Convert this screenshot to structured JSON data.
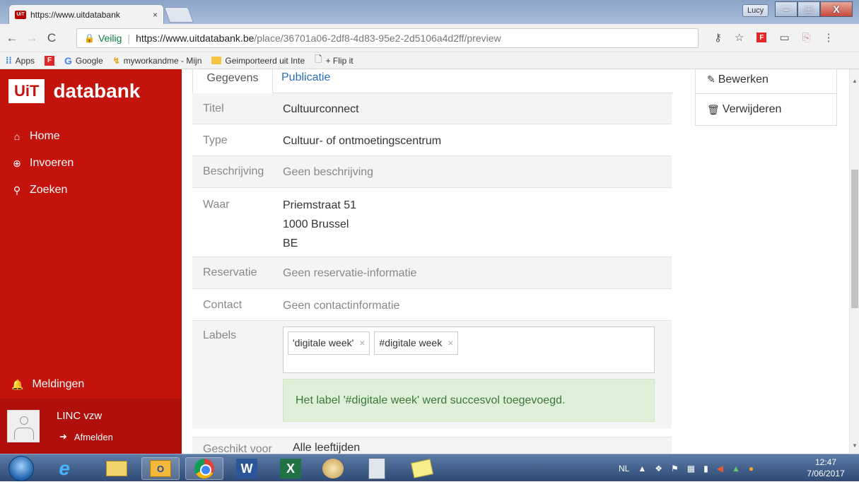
{
  "browser": {
    "tab_title": "https://www.uitdatabank",
    "tab_close": "×",
    "user_badge": "Lucy",
    "window_minimize": "–",
    "window_maximize": "□",
    "window_close": "X",
    "nav_back": "←",
    "nav_forward": "→",
    "nav_reload": "C",
    "secure_label": "Veilig",
    "url_host": "https://www.uitdatabank.be",
    "url_path": "/place/36701a06-2df8-4d83-95e2-2d5106a4d2ff/preview",
    "bookmarks": [
      {
        "label": "Apps",
        "icon": "apps-icon"
      },
      {
        "label": "",
        "icon": "flipboard-icon"
      },
      {
        "label": "Google",
        "icon": "google-icon"
      },
      {
        "label": "myworkandme - Mijn",
        "icon": "myworkandme-icon"
      },
      {
        "label": "Geimporteerd uit Inte",
        "icon": "folder-icon"
      },
      {
        "label": "+ Flip it",
        "icon": "page-icon"
      }
    ]
  },
  "sidebar": {
    "logo_box": "UiT",
    "logo_text": "databank",
    "nav": [
      {
        "label": "Home",
        "icon": "home-icon"
      },
      {
        "label": "Invoeren",
        "icon": "plus-circle-icon"
      },
      {
        "label": "Zoeken",
        "icon": "search-icon"
      }
    ],
    "notifications_label": "Meldingen",
    "user_name": "LINC vzw",
    "logout_label": "Afmelden"
  },
  "main": {
    "tabs": [
      {
        "label": "Gegevens"
      },
      {
        "label": "Publicatie"
      }
    ],
    "rows": {
      "titel": {
        "label": "Titel",
        "value": "Cultuurconnect"
      },
      "type": {
        "label": "Type",
        "value": "Cultuur- of ontmoetingscentrum"
      },
      "beschrijving": {
        "label": "Beschrijving",
        "value": "Geen beschrijving"
      },
      "waar": {
        "label": "Waar",
        "lines": [
          "Priemstraat 51",
          "1000 Brussel",
          "BE"
        ]
      },
      "reservatie": {
        "label": "Reservatie",
        "value": "Geen reservatie-informatie"
      },
      "contact": {
        "label": "Contact",
        "value": "Geen contactinformatie"
      },
      "labels": {
        "label": "Labels",
        "tags": [
          "'digitale week'",
          "#digitale week"
        ],
        "tag_remove": "×"
      },
      "geschikt": {
        "label": "Geschikt voor",
        "value": "Alle leeftijden"
      }
    },
    "success_message": "Het label '#digitale week' werd succesvol toegevoegd."
  },
  "actions": {
    "edit_label": "Bewerken",
    "delete_label": "Verwijderen"
  },
  "taskbar": {
    "language": "NL",
    "time": "12:47",
    "date": "7/06/2017"
  },
  "colors": {
    "brand_red": "#c4120d",
    "link_blue": "#2a6ebb",
    "success_bg": "#dff0d8",
    "success_text": "#3c763d"
  }
}
